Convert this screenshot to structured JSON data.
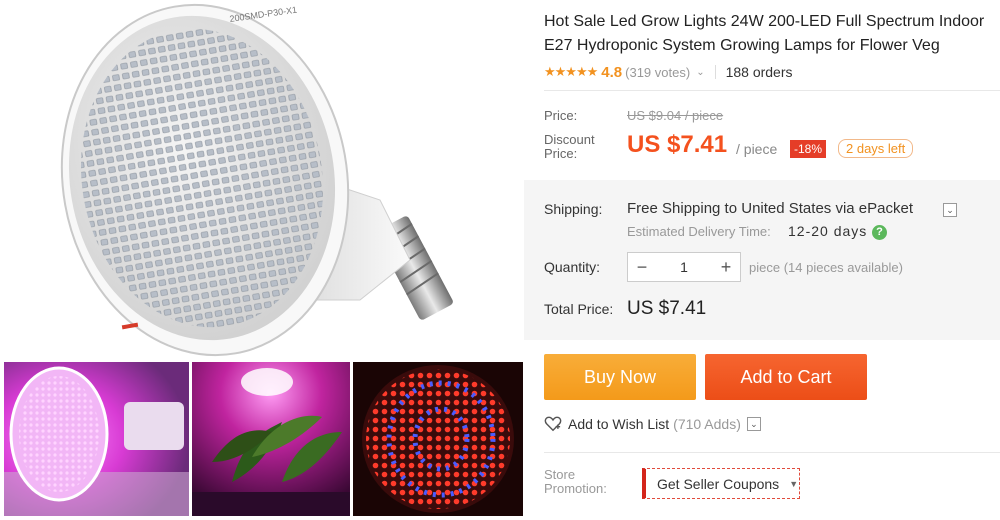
{
  "product": {
    "title_line1": "Hot Sale Led Grow Lights 24W 200-LED Full Spectrum Indoor",
    "title_line2": "E27 Hydroponic System Growing Lamps for Flower Veg",
    "stars": "★★★★★",
    "rating": "4.8",
    "votes": "(319 votes)",
    "orders": "188 orders",
    "bulb_label": "200SMD-P30-X1"
  },
  "pricing": {
    "price_label": "Price:",
    "old_price": "US $9.04 / piece",
    "discount_label_line1": "Discount",
    "discount_label_line2": "Price:",
    "current_price": "US $7.41",
    "per_piece": "/ piece",
    "discount_badge": "-18%",
    "days_left": "2 days left"
  },
  "shipping": {
    "label": "Shipping:",
    "text": "Free Shipping to United States via ePacket",
    "eta_label": "Estimated Delivery Time:",
    "eta_days": "12-20 days"
  },
  "quantity": {
    "label": "Quantity:",
    "minus": "−",
    "value": "1",
    "plus": "+",
    "note": "piece (14 pieces available)"
  },
  "total": {
    "label": "Total Price:",
    "value": "US $7.41"
  },
  "actions": {
    "buy_now": "Buy Now",
    "add_to_cart": "Add to Cart",
    "wishlist": "Add to Wish List",
    "wishlist_adds": "(710 Adds)"
  },
  "store": {
    "label_line1": "Store",
    "label_line2": "Promotion:",
    "coupon": "Get Seller Coupons"
  },
  "colors": {
    "accent_orange": "#f29220",
    "price_red": "#f4511e",
    "buy_now": "#f5a623",
    "add_to_cart": "#f15a22",
    "badge_red": "#e53d28",
    "help_green": "#5cb85c"
  },
  "icons": {
    "star": "star-icon",
    "chevron": "chevron-down-icon",
    "help": "question-icon",
    "heart": "heart-icon",
    "caret": "caret-down-icon"
  }
}
